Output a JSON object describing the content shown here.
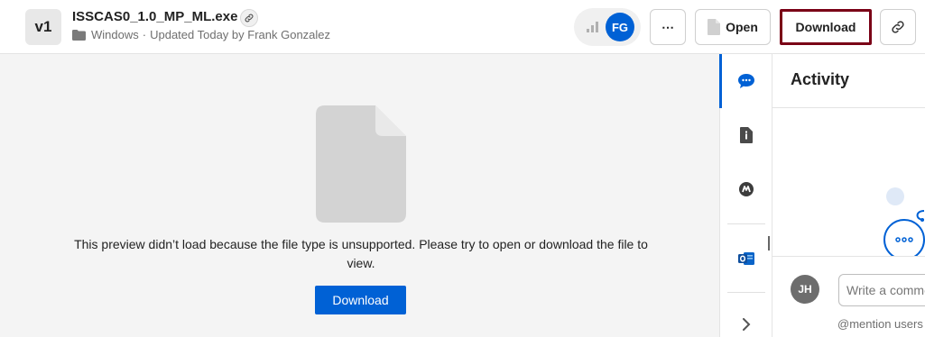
{
  "header": {
    "version": "v1",
    "file_name": "ISSCAS0_1.0_MP_ML.exe",
    "folder": "Windows",
    "separator": "·",
    "updated": "Updated Today by Frank Gonzalez",
    "collaborator_initials": "FG",
    "buttons": {
      "more": "⋯",
      "open": "Open",
      "download": "Download"
    }
  },
  "preview": {
    "message": "This preview didn’t load because the file type is unsupported. Please try to open or download the file to view.",
    "download_label": "Download"
  },
  "sidebar": {
    "items": [
      {
        "icon": "comment-icon",
        "active": true
      },
      {
        "icon": "info-icon",
        "active": false
      },
      {
        "icon": "metadata-icon",
        "active": false
      },
      {
        "icon": "outlook-icon",
        "active": false
      },
      {
        "icon": "chevron-right-icon",
        "active": false
      }
    ]
  },
  "activity": {
    "title": "Activity",
    "user_initials": "JH",
    "comment_placeholder": "Write a comment",
    "mention_hint": "@mention users"
  },
  "colors": {
    "brand_blue": "#0061d5",
    "download_outline": "#7a0016",
    "preview_bg": "#f4f4f4"
  }
}
